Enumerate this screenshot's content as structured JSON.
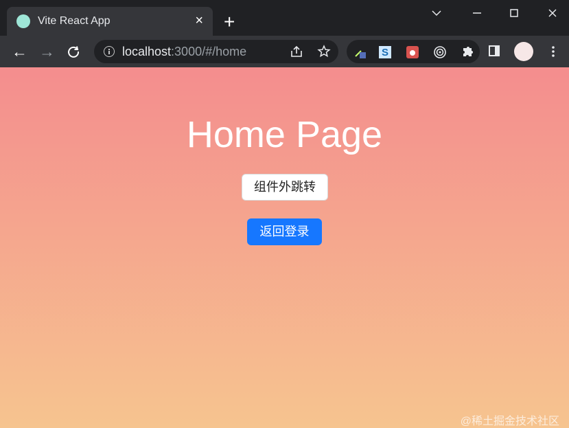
{
  "browser": {
    "tab_title": "Vite React App",
    "address": "localhost",
    "address_rest": ":3000/#/home"
  },
  "page": {
    "title": "Home Page",
    "buttons": {
      "outside_jump": "组件外跳转",
      "back_to_login": "返回登录"
    },
    "watermark": "@稀土掘金技术社区"
  },
  "colors": {
    "chrome_dark": "#202124",
    "chrome_mid": "#35363a",
    "gradient_top": "#f48d8e",
    "gradient_bottom": "#f6c48f",
    "primary": "#1677ff"
  },
  "icons": {
    "tab_favicon": "vite-favicon-icon",
    "close": "close-icon",
    "new_tab": "plus-icon",
    "back": "arrow-left-icon",
    "forward": "arrow-right-icon",
    "reload": "reload-icon",
    "info": "info-icon",
    "share": "share-icon",
    "bookmark": "star-icon",
    "extensions": "puzzle-icon",
    "sidepanel": "side-panel-icon",
    "menu": "kebab-menu-icon"
  }
}
